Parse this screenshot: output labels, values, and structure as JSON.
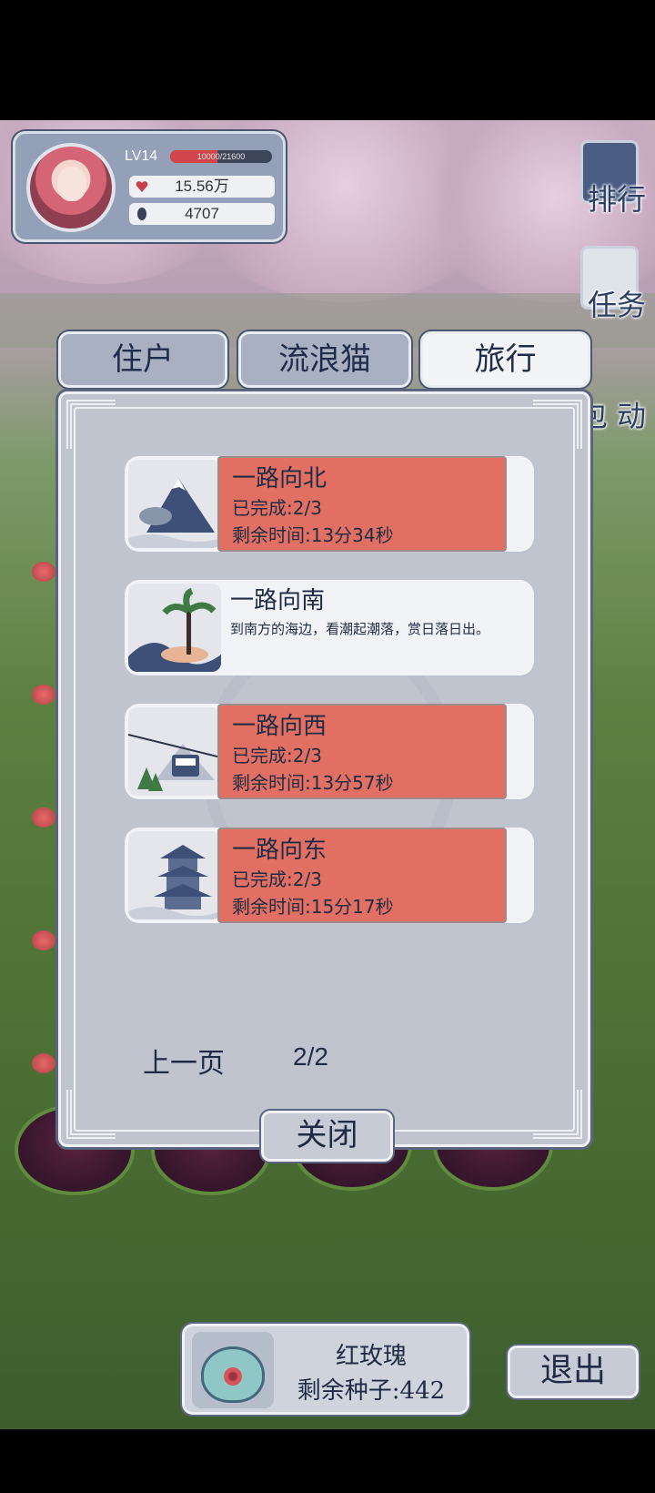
{
  "player": {
    "level": "LV14",
    "xp_text": "10000/21600",
    "xp_fraction": 0.46,
    "love_value": "15.56万",
    "seed_value": "4707"
  },
  "side_menu": {
    "rank": "排行",
    "tasks": "任务",
    "bag": "包",
    "events": "动"
  },
  "tabs": {
    "residents": "住户",
    "stray_cats": "流浪猫",
    "travel": "旅行",
    "active": "travel"
  },
  "trips": [
    {
      "title": "一路向北",
      "progress": "已完成:2/3",
      "remaining": "剩余时间:13分34秒",
      "status": "in-progress"
    },
    {
      "title": "一路向南",
      "description": "到南方的海边，看潮起潮落，赏日落日出。",
      "status": "available"
    },
    {
      "title": "一路向西",
      "progress": "已完成:2/3",
      "remaining": "剩余时间:13分57秒",
      "status": "in-progress"
    },
    {
      "title": "一路向东",
      "progress": "已完成:2/3",
      "remaining": "剩余时间:15分17秒",
      "status": "in-progress"
    }
  ],
  "pagination": {
    "prev_label": "上一页",
    "page": "2/2"
  },
  "close_label": "关闭",
  "seed": {
    "name": "红玫瑰",
    "count": "剩余种子:442"
  },
  "exit_label": "退出",
  "colors": {
    "in_progress_bg": "#e17063",
    "panel_bg": "#c0c4cf",
    "text_navy": "#1f2b45"
  }
}
